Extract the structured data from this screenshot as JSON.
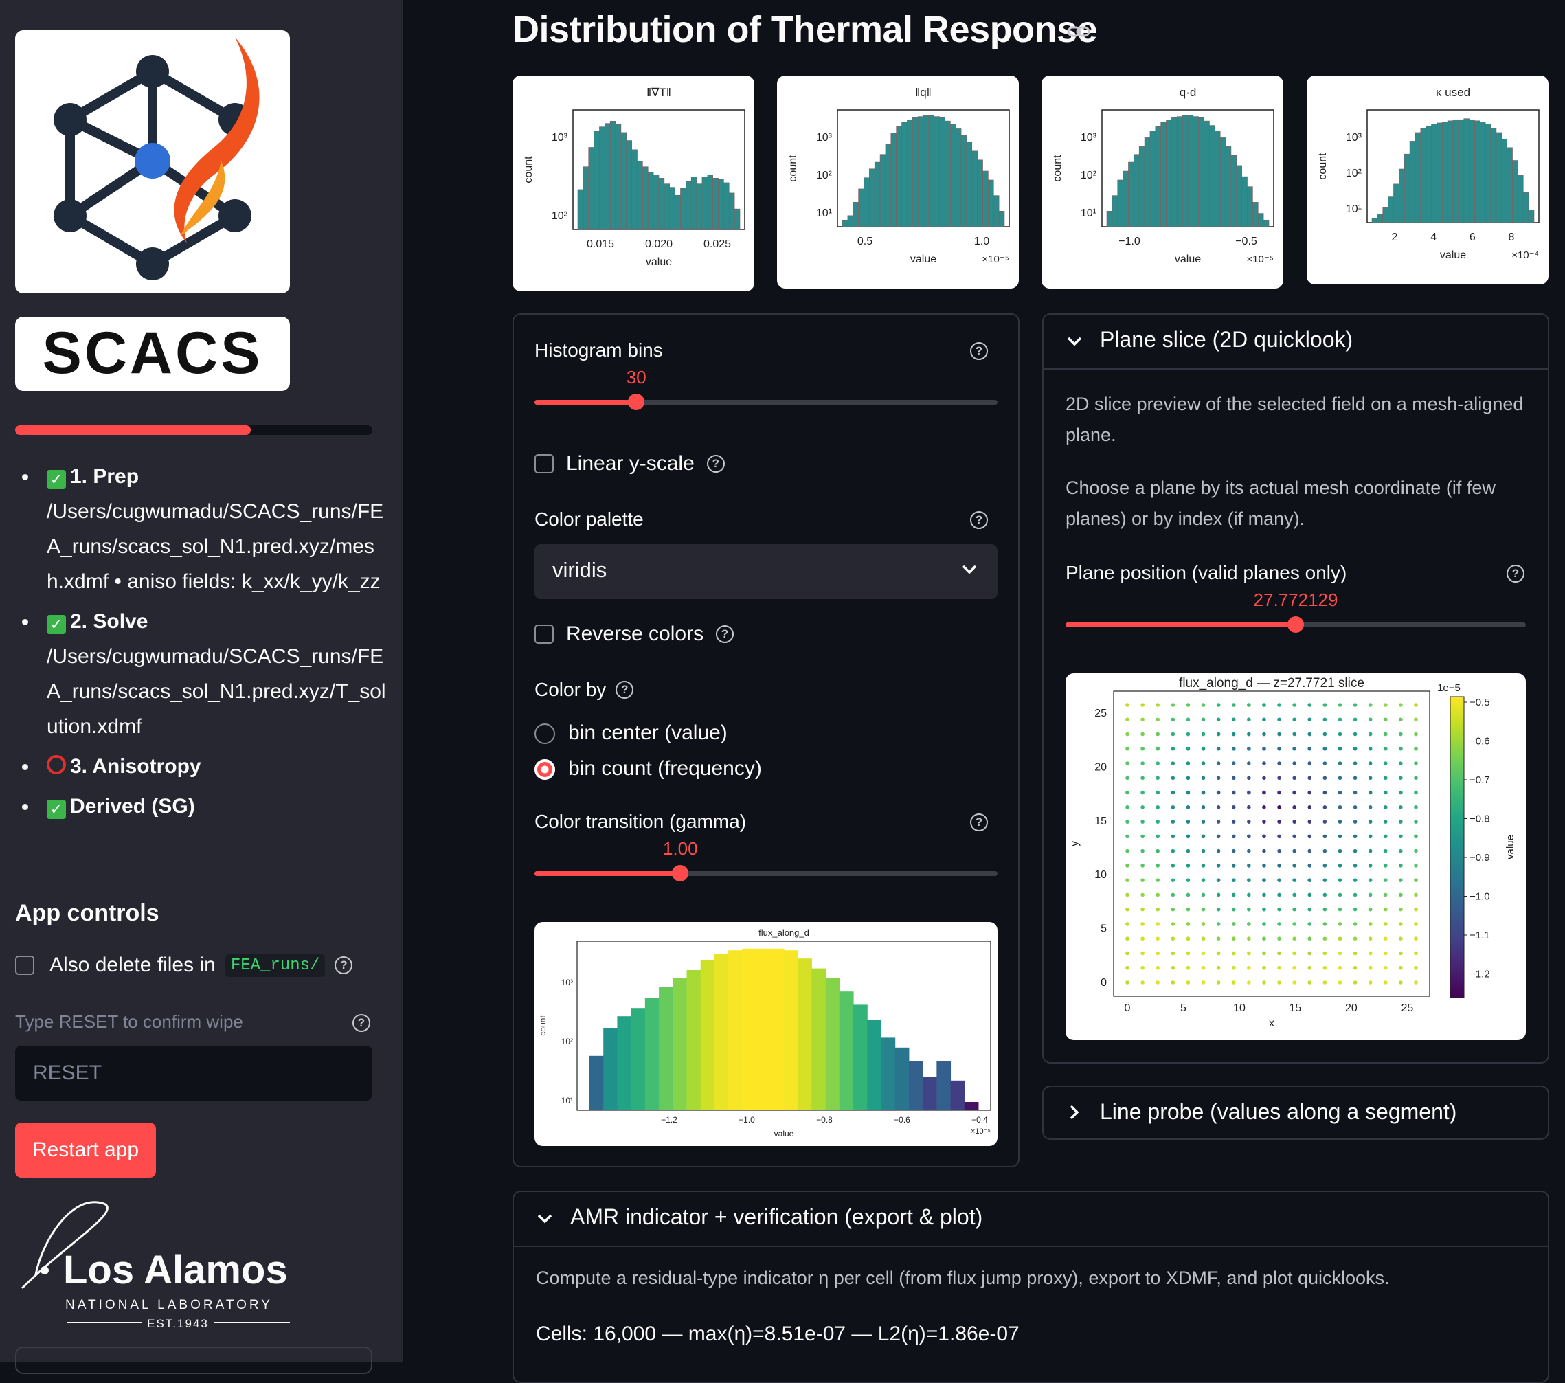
{
  "sidebar": {
    "logo_word": "SCACS",
    "progress_fraction": 0.66,
    "steps": [
      {
        "status": "done",
        "title": "1. Prep",
        "detail": "/Users/cugwumadu/SCACS_runs/FEA_runs/scacs_sol_N1.pred.xyz/mesh.xdmf • aniso fields: k_xx/k_yy/k_zz"
      },
      {
        "status": "done",
        "title": "2. Solve",
        "detail": "/Users/cugwumadu/SCACS_runs/FEA_runs/scacs_sol_N1.pred.xyz/T_solution.xdmf"
      },
      {
        "status": "pending",
        "title": "3. Anisotropy",
        "detail": ""
      },
      {
        "status": "done",
        "title": "Derived (SG)",
        "detail": ""
      }
    ],
    "check_glyph": "✓",
    "app_controls_title": "App controls",
    "delete_files_label": "Also delete files in",
    "delete_files_dir": "FEA_runs/",
    "confirm_label": "Type RESET to confirm wipe",
    "confirm_placeholder": "RESET",
    "restart_label": "Restart app",
    "lanl": {
      "name": "Los Alamos",
      "sub": "NATIONAL LABORATORY",
      "est": "EST.1943"
    }
  },
  "main": {
    "title": "Distribution of Thermal Response",
    "help_glyph": "?",
    "histograms": [
      {
        "title": "‖∇T‖",
        "ylabel": "count",
        "xlabel": "value",
        "xticks": [
          "0.015",
          "0.020",
          "0.025"
        ],
        "yticks": [
          "10³",
          "10²"
        ],
        "multiplier": "",
        "values": [
          0.35,
          0.55,
          0.72,
          0.86,
          0.9,
          0.93,
          0.95,
          0.92,
          0.85,
          0.78,
          0.7,
          0.6,
          0.55,
          0.5,
          0.48,
          0.45,
          0.4,
          0.37,
          0.3,
          0.36,
          0.42,
          0.46,
          0.4,
          0.46,
          0.48,
          0.45,
          0.44,
          0.41,
          0.32,
          0.18
        ]
      },
      {
        "title": "‖q‖",
        "ylabel": "count",
        "xlabel": "value",
        "xticks": [
          "0.5",
          "1.0"
        ],
        "yticks": [
          "10³",
          "10²",
          "10¹"
        ],
        "multiplier": "×10⁻⁵",
        "values": [
          0.06,
          0.1,
          0.22,
          0.34,
          0.44,
          0.52,
          0.58,
          0.65,
          0.74,
          0.84,
          0.9,
          0.94,
          0.96,
          0.98,
          0.99,
          1.0,
          1.0,
          0.99,
          0.98,
          0.95,
          0.92,
          0.88,
          0.82,
          0.76,
          0.68,
          0.6,
          0.5,
          0.42,
          0.28,
          0.14
        ]
      },
      {
        "title": "q·d",
        "ylabel": "count",
        "xlabel": "value",
        "xticks": [
          "−1.0",
          "−0.5"
        ],
        "yticks": [
          "10³",
          "10²",
          "10¹"
        ],
        "multiplier": "×10⁻⁵",
        "values": [
          0.14,
          0.28,
          0.42,
          0.5,
          0.58,
          0.65,
          0.72,
          0.8,
          0.86,
          0.9,
          0.94,
          0.96,
          0.98,
          0.99,
          1.0,
          1.0,
          0.99,
          0.98,
          0.95,
          0.91,
          0.86,
          0.8,
          0.72,
          0.64,
          0.55,
          0.45,
          0.36,
          0.22,
          0.12,
          0.06
        ]
      },
      {
        "title": "κ used",
        "ylabel": "count",
        "xlabel": "value",
        "xticks": [
          "2",
          "4",
          "6",
          "8"
        ],
        "yticks": [
          "10³",
          "10²",
          "10¹"
        ],
        "multiplier": "×10⁻⁴",
        "values": [
          0.04,
          0.08,
          0.14,
          0.24,
          0.36,
          0.5,
          0.64,
          0.76,
          0.84,
          0.88,
          0.9,
          0.92,
          0.93,
          0.94,
          0.95,
          0.96,
          0.96,
          0.97,
          0.96,
          0.95,
          0.94,
          0.92,
          0.88,
          0.84,
          0.78,
          0.7,
          0.58,
          0.44,
          0.28,
          0.12
        ]
      }
    ],
    "controls": {
      "bins_label": "Histogram bins",
      "bins_value": "30",
      "bins_fraction": 0.22,
      "linear_label": "Linear y-scale",
      "palette_label": "Color palette",
      "palette_value": "viridis",
      "reverse_label": "Reverse colors",
      "colorby_label": "Color by",
      "colorby_options": [
        "bin center (value)",
        "bin count (frequency)"
      ],
      "colorby_selected": 1,
      "gamma_label": "Color transition (gamma)",
      "gamma_value": "1.00",
      "gamma_fraction": 0.315
    },
    "flux_hist": {
      "title": "flux_along_d",
      "ylabel": "count",
      "xlabel": "value",
      "xticks": [
        "−1.2",
        "−1.0",
        "−0.8",
        "−0.6",
        "−0.4"
      ],
      "yticks": [
        "10³",
        "10²",
        "10¹"
      ],
      "multiplier": "×10⁻⁵",
      "values": [
        0.33,
        0.5,
        0.57,
        0.62,
        0.68,
        0.75,
        0.8,
        0.85,
        0.91,
        0.95,
        0.97,
        0.98,
        0.98,
        0.98,
        0.97,
        0.92,
        0.86,
        0.8,
        0.72,
        0.64,
        0.55,
        0.44,
        0.38,
        0.3,
        0.2,
        0.3,
        0.18,
        0.05
      ]
    },
    "plane": {
      "title": "Plane slice (2D quicklook)",
      "desc1": "2D slice preview of the selected field on a mesh-aligned plane.",
      "desc2": "Choose a plane by its actual mesh coordinate (if few planes) or by index (if many).",
      "position_label": "Plane position (valid planes only)",
      "position_value": "27.772129",
      "position_fraction": 0.5,
      "plot_title": "flux_along_d — z=27.7721 slice",
      "xlabel": "x",
      "ylabel": "y",
      "colorbar_label": "value",
      "colorbar_exp": "1e−5",
      "xticks": [
        "0",
        "5",
        "10",
        "15",
        "20",
        "25"
      ],
      "yticks": [
        "0",
        "5",
        "10",
        "15",
        "20",
        "25"
      ],
      "cbar_ticks": [
        "−0.5",
        "−0.6",
        "−0.7",
        "−0.8",
        "−0.9",
        "−1.0",
        "−1.1",
        "−1.2"
      ],
      "grid_n": 20
    },
    "line_probe": {
      "title": "Line probe (values along a segment)"
    },
    "amr": {
      "title": "AMR indicator + verification (export & plot)",
      "desc": "Compute a residual-type indicator η per cell (from flux jump proxy), export to XDMF, and plot quicklooks.",
      "stats": "Cells: 16,000 — max(η)=8.51e-07 — L2(η)=1.86e-07"
    },
    "colors": {
      "accent": "#ff4b4b",
      "hist_fill": "#2e8b8b",
      "panel_border": "#31333f"
    }
  }
}
